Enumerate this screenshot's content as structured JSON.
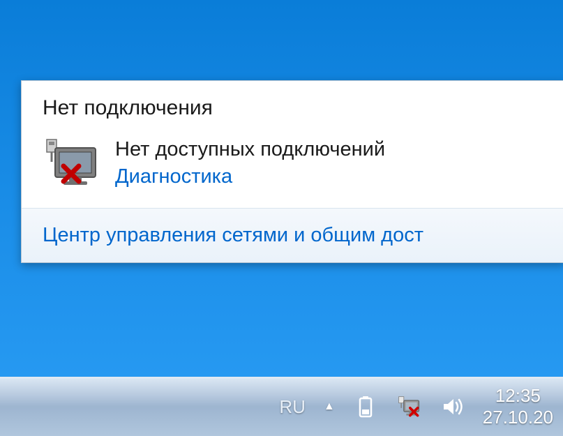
{
  "popup": {
    "title": "Нет подключения",
    "status": "Нет доступных подключений",
    "diagnose_link": "Диагностика",
    "footer_link": "Центр управления сетями и общим дост"
  },
  "tray": {
    "language": "RU",
    "time": "12:35",
    "date": "27.10.20"
  },
  "icons": {
    "network_disconnected": "network-disconnected-icon",
    "battery": "battery-icon",
    "network_tray": "network-tray-icon",
    "volume": "volume-icon",
    "show_hidden": "show-hidden-icons"
  }
}
